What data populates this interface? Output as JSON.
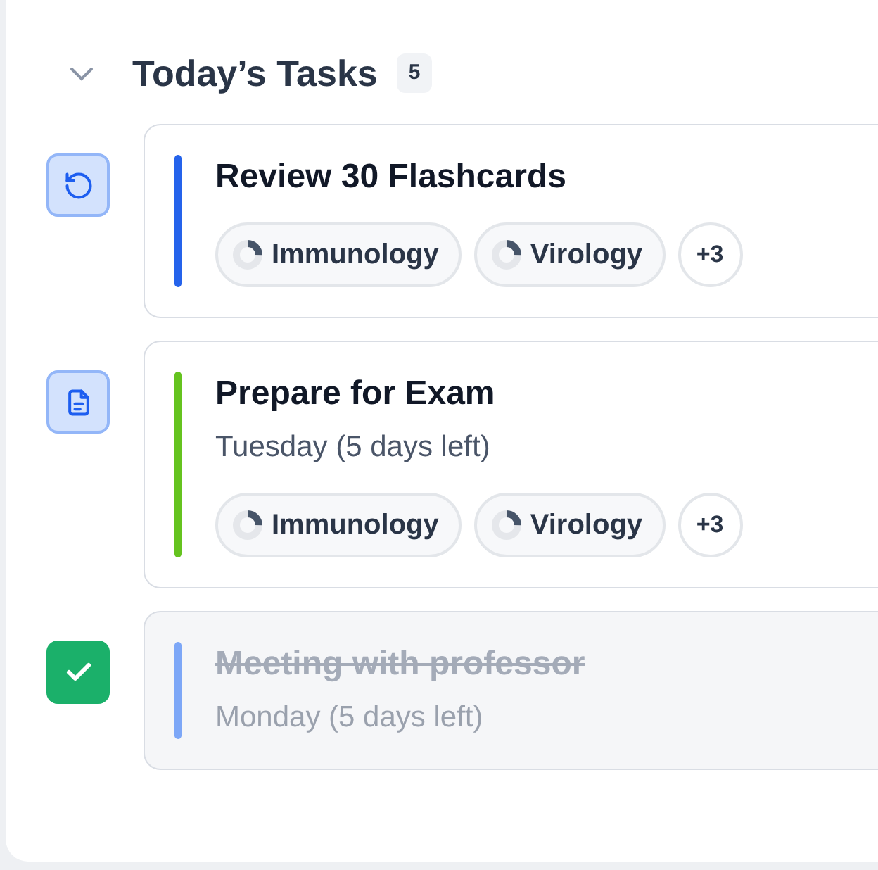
{
  "section": {
    "title": "Today’s Tasks",
    "count": "5",
    "expanded": true
  },
  "tasks": [
    {
      "kind": "repeat",
      "title": "Review 30 Flashcards",
      "completed": false,
      "color": "#2563eb",
      "tags": [
        {
          "label": "Immunology",
          "level": 0.25
        },
        {
          "label": "Virology",
          "level": 0.25
        }
      ],
      "more": "+3"
    },
    {
      "kind": "document",
      "title": "Prepare for Exam",
      "due": "Tuesday (5 days left)",
      "completed": false,
      "color": "#65c31f",
      "tags": [
        {
          "label": "Immunology",
          "level": 0.25
        },
        {
          "label": "Virology",
          "level": 0.25
        }
      ],
      "more": "+3"
    },
    {
      "kind": "done",
      "title": "Meeting with professor",
      "due": "Monday (5 days left)",
      "completed": true,
      "color": "#7da7f7"
    }
  ]
}
